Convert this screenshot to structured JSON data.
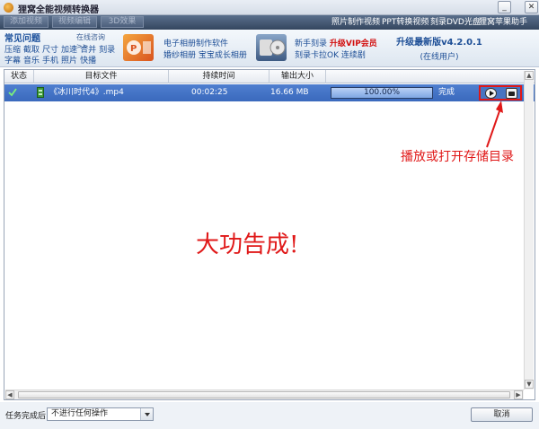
{
  "window": {
    "title": "狸窝全能视频转换器"
  },
  "toolbar": {
    "buttons": [
      "添加视频",
      "视频编辑",
      "3D效果"
    ],
    "links": [
      "照片制作视频",
      "PPT转换视频",
      "刻录DVD光盘",
      "狸窝苹果助手"
    ]
  },
  "faq": {
    "title": "常见问题",
    "more": "在线咨询>>",
    "row1": [
      "压缩",
      "截取",
      "尺寸",
      "加速",
      "合并",
      "刻录"
    ],
    "row2": [
      "字幕",
      "音乐",
      "手机",
      "照片",
      "快播"
    ]
  },
  "promos": [
    {
      "line1": "电子相册制作软件",
      "line2": "婚纱相册  宝宝成长相册"
    },
    {
      "line1a": "新手刻录",
      "line1b": "升级VIP会员",
      "line2": "刻录卡拉OK  连续剧"
    }
  ],
  "upgrade": {
    "title": "升级最新版v4.2.0.1",
    "status": "(在线用户)"
  },
  "table": {
    "headers": [
      "状态",
      "目标文件",
      "持续时间",
      "输出大小"
    ],
    "rows": [
      {
        "file": "《冰川时代4》.mp4",
        "duration": "00:02:25",
        "size": "16.66 MB",
        "progress_text": "100.00%",
        "progress": 1.0,
        "status": "完成"
      }
    ]
  },
  "annotation": "播放或打开存储目录",
  "headline": "大功告成!",
  "bottom": {
    "after_label": "任务完成后:",
    "after_value": "不进行任何操作",
    "cancel": "取消"
  },
  "colors": {
    "accent_red": "#e01818",
    "row_selected": "#3f6fc3"
  }
}
